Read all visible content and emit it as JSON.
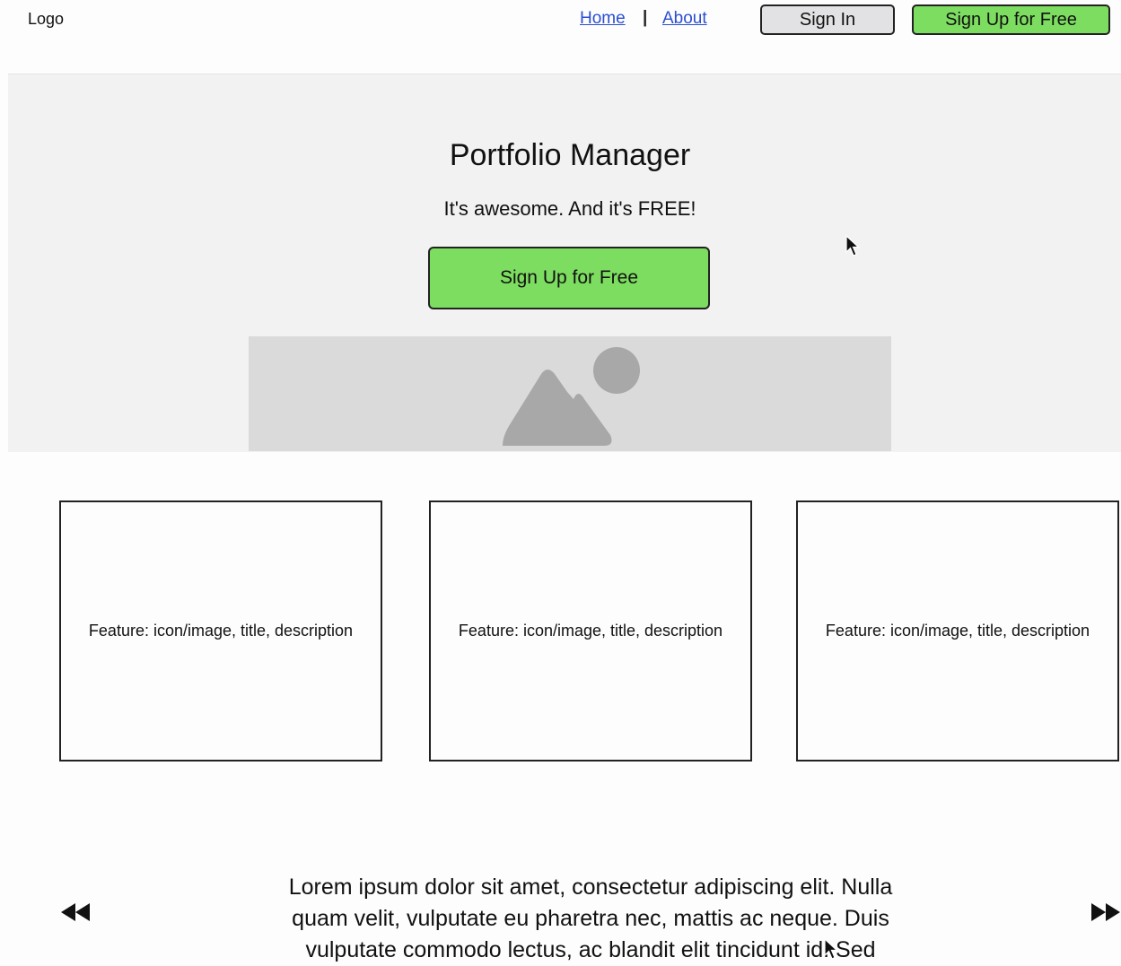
{
  "header": {
    "logo": "Logo",
    "nav": {
      "home": "Home",
      "separator": "|",
      "about": "About"
    },
    "sign_in": "Sign In",
    "sign_up": "Sign Up for Free"
  },
  "hero": {
    "title": "Portfolio Manager",
    "subtitle": "It's awesome. And it's FREE!",
    "cta": "Sign Up for Free",
    "image_icon": "image-placeholder-icon"
  },
  "features": [
    {
      "text": "Feature: icon/image, title, description"
    },
    {
      "text": "Feature: icon/image, title, description"
    },
    {
      "text": "Feature: icon/image, title, description"
    }
  ],
  "testimonial": {
    "text": "Lorem ipsum dolor sit amet, consectetur adipiscing elit. Nulla quam velit, vulputate eu pharetra nec, mattis ac neque. Duis vulputate commodo lectus, ac blandit elit tincidunt id. Sed",
    "prev_icon": "rewind-icon",
    "next_icon": "fast-forward-icon"
  },
  "colors": {
    "accent_green": "#7ddd60",
    "secondary_gray": "#e2e2e4",
    "hero_bg": "#f2f2f2",
    "image_placeholder": "#dadadb",
    "link": "#2b4fd0"
  }
}
